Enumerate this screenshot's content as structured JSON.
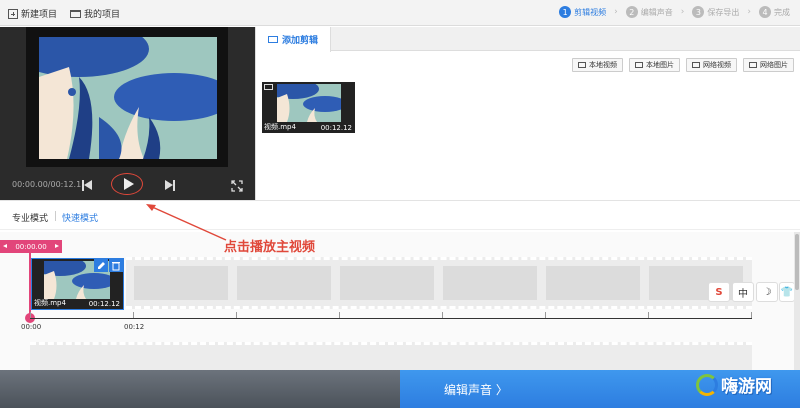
{
  "topbar": {
    "new_project": "新建项目",
    "my_projects": "我的项目",
    "steps": [
      {
        "num": "1",
        "label": "剪辑视频"
      },
      {
        "num": "2",
        "label": "编辑声音"
      },
      {
        "num": "3",
        "label": "保存导出"
      },
      {
        "num": "4",
        "label": "完成"
      }
    ]
  },
  "player": {
    "time": "00:00.00/00:12.1"
  },
  "clips_panel": {
    "tab": "添加剪辑",
    "buttons": [
      "本地视频",
      "本地图片",
      "网络视频",
      "网络图片"
    ],
    "clip": {
      "name": "视频.mp4",
      "duration": "00:12.12"
    }
  },
  "modes": {
    "pro": "专业模式",
    "fast": "快速模式"
  },
  "annotation": "点击播放主视频",
  "timeline": {
    "playhead": "00:00.00",
    "clip": {
      "name": "视频.mp4",
      "duration": "00:12.12"
    },
    "ticks": [
      "00:00",
      "00:12"
    ]
  },
  "ime": [
    "S",
    "中",
    "☽",
    "👕"
  ],
  "footer": {
    "next": "编辑声音 〉"
  },
  "watermark": "嗨游网",
  "colors": {
    "accent": "#2d7de0",
    "annotation": "#e0483a",
    "playhead": "#e2457a"
  }
}
